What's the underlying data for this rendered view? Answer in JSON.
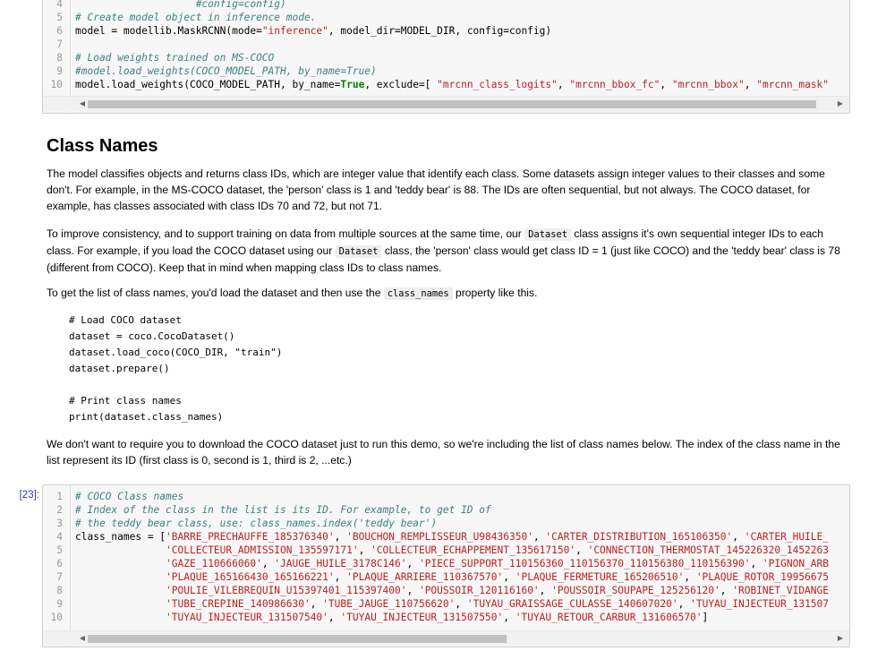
{
  "cell_top": {
    "lines": [
      {
        "n": "4",
        "parts": [
          {
            "c": "cm",
            "t": "                    #config=config)"
          }
        ]
      },
      {
        "n": "5",
        "parts": [
          {
            "c": "cm",
            "t": "# Create model object in inference mode."
          }
        ]
      },
      {
        "n": "6",
        "parts": [
          {
            "c": "",
            "t": "model = modellib.MaskRCNN(mode="
          },
          {
            "c": "st",
            "t": "\"inference\""
          },
          {
            "c": "",
            "t": ", model_dir=MODEL_DIR, config=config)"
          }
        ]
      },
      {
        "n": "7",
        "parts": []
      },
      {
        "n": "8",
        "parts": [
          {
            "c": "cm",
            "t": "# Load weights trained on MS-COCO"
          }
        ]
      },
      {
        "n": "9",
        "parts": [
          {
            "c": "cm",
            "t": "#model.load_weights(COCO_MODEL_PATH, by_name=True)"
          }
        ]
      },
      {
        "n": "10",
        "parts": [
          {
            "c": "",
            "t": "model.load_weights(COCO_MODEL_PATH, by_name="
          },
          {
            "c": "kw",
            "t": "True"
          },
          {
            "c": "",
            "t": ", exclude=[ "
          },
          {
            "c": "st",
            "t": "\"mrcnn_class_logits\""
          },
          {
            "c": "",
            "t": ", "
          },
          {
            "c": "st",
            "t": "\"mrcnn_bbox_fc\""
          },
          {
            "c": "",
            "t": ", "
          },
          {
            "c": "st",
            "t": "\"mrcnn_bbox\""
          },
          {
            "c": "",
            "t": ", "
          },
          {
            "c": "st",
            "t": "\"mrcnn_mask\""
          }
        ]
      }
    ]
  },
  "markdown": {
    "heading": "Class Names",
    "p1": "The model classifies objects and returns class IDs, which are integer value that identify each class. Some datasets assign integer values to their classes and some don't. For example, in the MS-COCO dataset, the 'person' class is 1 and 'teddy bear' is 88. The IDs are often sequential, but not always. The COCO dataset, for example, has classes associated with class IDs 70 and 72, but not 71.",
    "p2_a": "To improve consistency, and to support training on data from multiple sources at the same time, our ",
    "p2_code1": "Dataset",
    "p2_b": " class assigns it's own sequential integer IDs to each class. For example, if you load the COCO dataset using our ",
    "p2_code2": "Dataset",
    "p2_c": " class, the 'person' class would get class ID = 1 (just like COCO) and the 'teddy bear' class is 78 (different from COCO). Keep that in mind when mapping class IDs to class names.",
    "p3_a": "To get the list of class names, you'd load the dataset and then use the ",
    "p3_code": "class_names",
    "p3_b": " property like this.",
    "code_block": "# Load COCO dataset\ndataset = coco.CocoDataset()\ndataset.load_coco(COCO_DIR, \"train\")\ndataset.prepare()\n\n# Print class names\nprint(dataset.class_names)",
    "p4": "We don't want to require you to download the COCO dataset just to run this demo, so we're including the list of class names below. The index of the class name in the list represent its ID (first class is 0, second is 1, third is 2, ...etc.)"
  },
  "cell_bottom": {
    "prompt": "[23]:",
    "lines": [
      {
        "n": "1",
        "parts": [
          {
            "c": "cm",
            "t": "# COCO Class names"
          }
        ]
      },
      {
        "n": "2",
        "parts": [
          {
            "c": "cm",
            "t": "# Index of the class in the list is its ID. For example, to get ID of"
          }
        ]
      },
      {
        "n": "3",
        "parts": [
          {
            "c": "cm",
            "t": "# the teddy bear class, use: class_names.index('teddy bear')"
          }
        ]
      },
      {
        "n": "4",
        "parts": [
          {
            "c": "",
            "t": "class_names = ["
          },
          {
            "c": "st",
            "t": "'BARRE_PRECHAUFFE_185376340'"
          },
          {
            "c": "",
            "t": ", "
          },
          {
            "c": "st",
            "t": "'BOUCHON_REMPLISSEUR_U98436350'"
          },
          {
            "c": "",
            "t": ", "
          },
          {
            "c": "st",
            "t": "'CARTER_DISTRIBUTION_165106350'"
          },
          {
            "c": "",
            "t": ", "
          },
          {
            "c": "st",
            "t": "'CARTER_HUILE_"
          }
        ]
      },
      {
        "n": "5",
        "parts": [
          {
            "c": "",
            "t": "               "
          },
          {
            "c": "st",
            "t": "'COLLECTEUR_ADMISSION_135597171'"
          },
          {
            "c": "",
            "t": ", "
          },
          {
            "c": "st",
            "t": "'COLLECTEUR_ECHAPPEMENT_135617150'"
          },
          {
            "c": "",
            "t": ", "
          },
          {
            "c": "st",
            "t": "'CONNECTION_THERMOSTAT_145226320_1452263"
          }
        ]
      },
      {
        "n": "6",
        "parts": [
          {
            "c": "",
            "t": "               "
          },
          {
            "c": "st",
            "t": "'GAZE_110666060'"
          },
          {
            "c": "",
            "t": ", "
          },
          {
            "c": "st",
            "t": "'JAUGE_HUILE_3178C146'"
          },
          {
            "c": "",
            "t": ", "
          },
          {
            "c": "st",
            "t": "'PIECE_SUPPORT_110156360_110156370_110156380_110156390'"
          },
          {
            "c": "",
            "t": ", "
          },
          {
            "c": "st",
            "t": "'PIGNON_ARB"
          }
        ]
      },
      {
        "n": "7",
        "parts": [
          {
            "c": "",
            "t": "               "
          },
          {
            "c": "st",
            "t": "'PLAQUE_165166430_165166221'"
          },
          {
            "c": "",
            "t": ", "
          },
          {
            "c": "st",
            "t": "'PLAQUE_ARRIERE_110367570'"
          },
          {
            "c": "",
            "t": ", "
          },
          {
            "c": "st",
            "t": "'PLAQUE_FERMETURE_165206510'"
          },
          {
            "c": "",
            "t": ", "
          },
          {
            "c": "st",
            "t": "'PLAQUE_ROTOR_19956675"
          }
        ]
      },
      {
        "n": "8",
        "parts": [
          {
            "c": "",
            "t": "               "
          },
          {
            "c": "st",
            "t": "'POULIE_VILEBREQUIN_U15397401_115397400'"
          },
          {
            "c": "",
            "t": ", "
          },
          {
            "c": "st",
            "t": "'POUSSOIR_120116160'"
          },
          {
            "c": "",
            "t": ", "
          },
          {
            "c": "st",
            "t": "'POUSSOIR_SOUPAPE_125256120'"
          },
          {
            "c": "",
            "t": ", "
          },
          {
            "c": "st",
            "t": "'ROBINET_VIDANGE"
          }
        ]
      },
      {
        "n": "9",
        "parts": [
          {
            "c": "",
            "t": "               "
          },
          {
            "c": "st",
            "t": "'TUBE_CREPINE_140986630'"
          },
          {
            "c": "",
            "t": ", "
          },
          {
            "c": "st",
            "t": "'TUBE_JAUGE_110756620'"
          },
          {
            "c": "",
            "t": ", "
          },
          {
            "c": "st",
            "t": "'TUYAU_GRAISSAGE_CULASSE_140607020'"
          },
          {
            "c": "",
            "t": ", "
          },
          {
            "c": "st",
            "t": "'TUYAU_INJECTEUR_131507"
          }
        ]
      },
      {
        "n": "10",
        "parts": [
          {
            "c": "",
            "t": "               "
          },
          {
            "c": "st",
            "t": "'TUYAU_INJECTEUR_131507540'"
          },
          {
            "c": "",
            "t": ", "
          },
          {
            "c": "st",
            "t": "'TUYAU_INJECTEUR_131507550'"
          },
          {
            "c": "",
            "t": ", "
          },
          {
            "c": "st",
            "t": "'TUYAU_RETOUR_CARBUR_131606570'"
          },
          {
            "c": "",
            "t": "]"
          }
        ]
      }
    ]
  },
  "scroll": {
    "left_arrow": "◀",
    "right_arrow": "▶"
  },
  "colors": {
    "comment": "#408080",
    "string": "#ba2121",
    "keyword": "#008000",
    "prompt": "#303f9f"
  }
}
